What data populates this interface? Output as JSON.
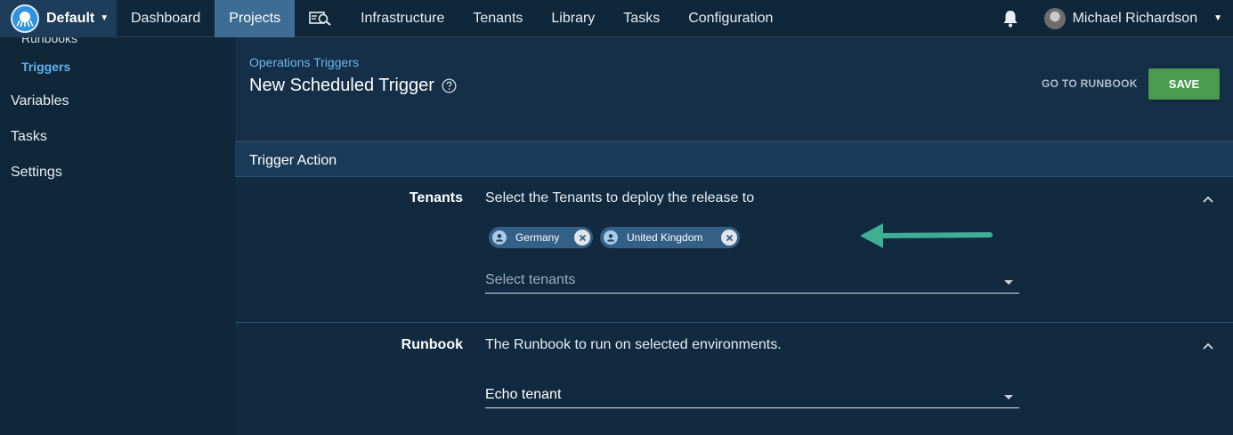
{
  "topnav": {
    "space_name": "Default",
    "items": [
      {
        "label": "Dashboard"
      },
      {
        "label": "Projects"
      },
      {
        "label": "Infrastructure"
      },
      {
        "label": "Tenants"
      },
      {
        "label": "Library"
      },
      {
        "label": "Tasks"
      },
      {
        "label": "Configuration"
      }
    ],
    "active": "Projects",
    "user_name": "Michael Richardson"
  },
  "sidebar": {
    "runbooks_label": "Runbooks",
    "triggers_label": "Triggers",
    "items": [
      {
        "label": "Variables"
      },
      {
        "label": "Tasks"
      },
      {
        "label": "Settings"
      }
    ]
  },
  "header": {
    "breadcrumb": "Operations Triggers",
    "title": "New Scheduled Trigger",
    "goto_label": "GO TO RUNBOOK",
    "save_label": "SAVE"
  },
  "section": {
    "title": "Trigger Action",
    "tenants": {
      "label": "Tenants",
      "description": "Select the Tenants to deploy the release to",
      "chips": [
        {
          "label": "Germany"
        },
        {
          "label": "United Kingdom"
        }
      ],
      "placeholder": "Select tenants"
    },
    "runbook": {
      "label": "Runbook",
      "description": "The Runbook to run on selected environments.",
      "value": "Echo tenant"
    }
  },
  "colors": {
    "accent": "#3d6d94",
    "link": "#6cb8ee",
    "save": "#4b9b4e",
    "arrow": "#3fae94"
  }
}
